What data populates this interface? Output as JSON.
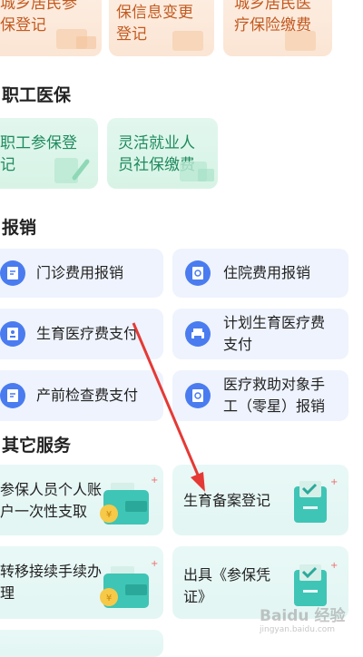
{
  "sections": {
    "resident": {
      "cards": [
        "城乡居民参\n保登记",
        "城乡居民参\n保信息变更\n登记",
        "城乡居民医\n疗保险缴费"
      ]
    },
    "employee": {
      "title": "职工医保",
      "cards": [
        "职工参保登\n记",
        "灵活就业人\n员社保缴费"
      ]
    },
    "reimburse": {
      "title": "报销",
      "items": [
        "门诊费用报销",
        "住院费用报销",
        "生育医疗费支付",
        "计划生育医疗费\n支付",
        "产前检查费支付",
        "医疗救助对象手\n工（零星）报销"
      ]
    },
    "other": {
      "title": "其它服务",
      "items": [
        "参保人员个人账\n户一次性支取",
        "生育备案登记",
        "转移接续手续办\n理",
        "出具《参保凭\n证》"
      ]
    }
  },
  "watermark": {
    "text": "Baidu 经验",
    "sub": "jingyan.baidu.com"
  },
  "colors": {
    "accent_blue": "#4a7cf0",
    "arrow_red": "#e53935",
    "orange_text": "#c25a20",
    "green_text": "#1f8b5e"
  },
  "icons": [
    "document-edit-icon",
    "search-document-icon",
    "id-card-icon",
    "printer-icon",
    "wallet-coin-icon",
    "checkbox-card-icon"
  ]
}
